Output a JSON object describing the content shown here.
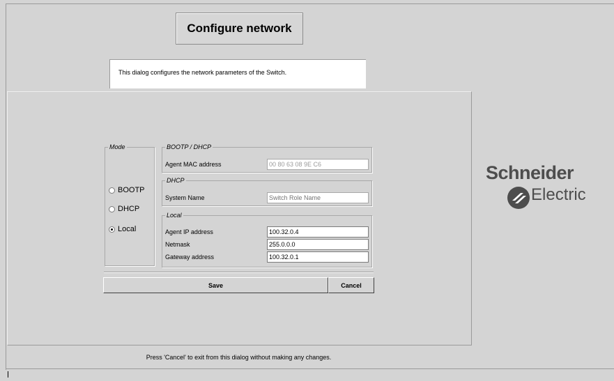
{
  "header": {
    "title": "Configure network",
    "description": "This dialog configures the network parameters of the Switch."
  },
  "mode": {
    "legend": "Mode",
    "options": [
      {
        "label": "BOOTP",
        "checked": false
      },
      {
        "label": "DHCP",
        "checked": false
      },
      {
        "label": "Local",
        "checked": true
      }
    ]
  },
  "bootp_dhcp": {
    "legend": "BOOTP / DHCP",
    "mac_label": "Agent MAC address",
    "mac_value": "00 80 63 08 9E C6"
  },
  "dhcp": {
    "legend": "DHCP",
    "system_name_label": "System Name",
    "system_name_placeholder": "Switch Role Name"
  },
  "local": {
    "legend": "Local",
    "ip_label": "Agent IP address",
    "ip_value": "100.32.0.4",
    "netmask_label": "Netmask",
    "netmask_value": "255.0.0.0",
    "gateway_label": "Gateway address",
    "gateway_value": "100.32.0.1"
  },
  "buttons": {
    "save": "Save",
    "cancel": "Cancel"
  },
  "footer": {
    "hint": "Press 'Cancel' to exit from this dialog without making any changes."
  },
  "logo": {
    "line1": "Schneider",
    "line2": "Electric",
    "color": "#4d4d4d"
  }
}
